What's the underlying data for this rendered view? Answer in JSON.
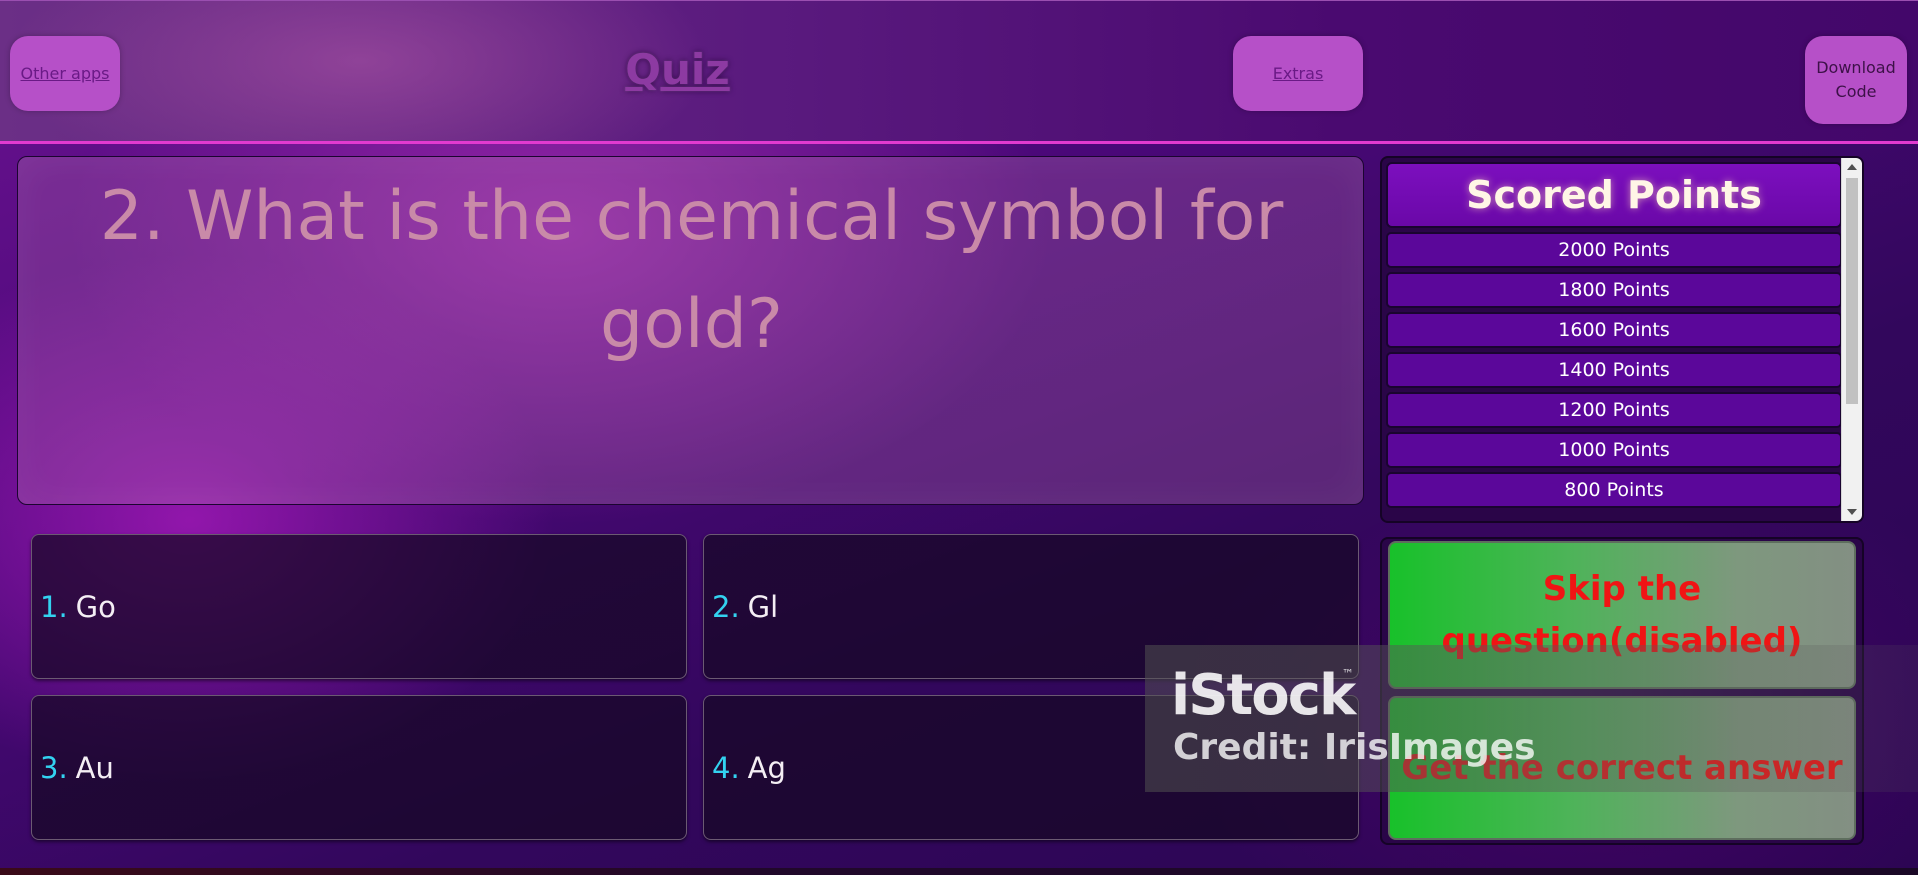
{
  "header": {
    "other_apps_label": "Other apps",
    "title": "Quiz",
    "extras_label": "Extras",
    "download_line1": "Download",
    "download_line2": "Code"
  },
  "question": {
    "text": "2. What is the chemical symbol for gold?"
  },
  "answers": [
    {
      "num": "1.",
      "text": "Go"
    },
    {
      "num": "2.",
      "text": "Gl"
    },
    {
      "num": "3.",
      "text": "Au"
    },
    {
      "num": "4.",
      "text": "Ag"
    }
  ],
  "score_panel": {
    "title": "Scored Points",
    "levels": [
      "2000 Points",
      "1800 Points",
      "1600 Points",
      "1400 Points",
      "1200 Points",
      "1000 Points",
      "800 Points"
    ]
  },
  "actions": {
    "skip_label": "Skip the question(disabled)",
    "correct_answer_label": "Get the correct answer"
  },
  "watermark": {
    "logo": "iStock",
    "tm": "™",
    "credit": "Credit: IrisImages"
  },
  "colors": {
    "accent_pink": "#e23ad0",
    "answer_number": "#33d2f0",
    "action_text": "#f01414",
    "action_green": "#18c12a",
    "score_row": "#5b079a"
  },
  "icons": {
    "scroll_up": "chevron-up-icon",
    "scroll_down": "chevron-down-icon"
  }
}
